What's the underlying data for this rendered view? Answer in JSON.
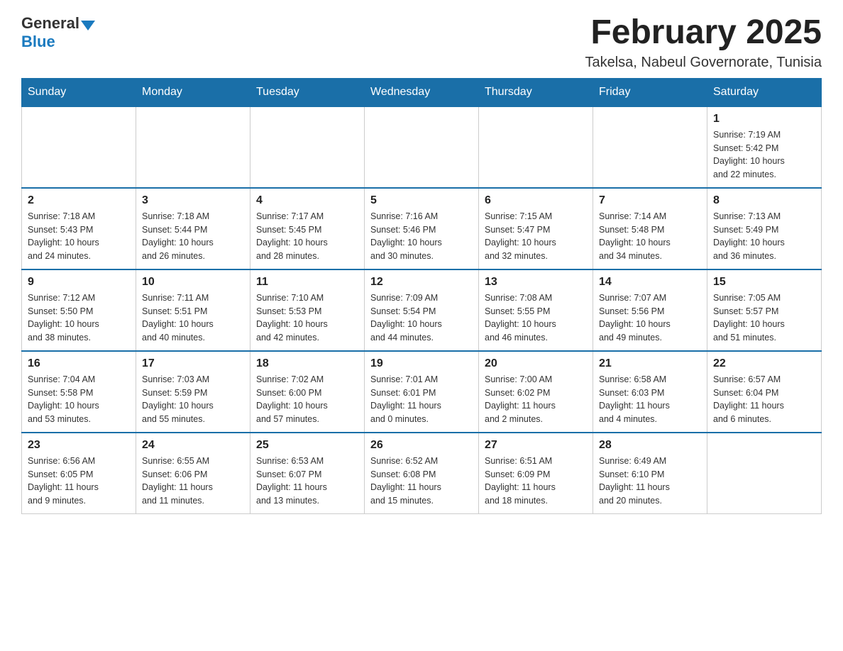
{
  "logo": {
    "general": "General",
    "blue": "Blue"
  },
  "title": "February 2025",
  "location": "Takelsa, Nabeul Governorate, Tunisia",
  "weekdays": [
    "Sunday",
    "Monday",
    "Tuesday",
    "Wednesday",
    "Thursday",
    "Friday",
    "Saturday"
  ],
  "weeks": [
    [
      {
        "day": "",
        "info": ""
      },
      {
        "day": "",
        "info": ""
      },
      {
        "day": "",
        "info": ""
      },
      {
        "day": "",
        "info": ""
      },
      {
        "day": "",
        "info": ""
      },
      {
        "day": "",
        "info": ""
      },
      {
        "day": "1",
        "info": "Sunrise: 7:19 AM\nSunset: 5:42 PM\nDaylight: 10 hours\nand 22 minutes."
      }
    ],
    [
      {
        "day": "2",
        "info": "Sunrise: 7:18 AM\nSunset: 5:43 PM\nDaylight: 10 hours\nand 24 minutes."
      },
      {
        "day": "3",
        "info": "Sunrise: 7:18 AM\nSunset: 5:44 PM\nDaylight: 10 hours\nand 26 minutes."
      },
      {
        "day": "4",
        "info": "Sunrise: 7:17 AM\nSunset: 5:45 PM\nDaylight: 10 hours\nand 28 minutes."
      },
      {
        "day": "5",
        "info": "Sunrise: 7:16 AM\nSunset: 5:46 PM\nDaylight: 10 hours\nand 30 minutes."
      },
      {
        "day": "6",
        "info": "Sunrise: 7:15 AM\nSunset: 5:47 PM\nDaylight: 10 hours\nand 32 minutes."
      },
      {
        "day": "7",
        "info": "Sunrise: 7:14 AM\nSunset: 5:48 PM\nDaylight: 10 hours\nand 34 minutes."
      },
      {
        "day": "8",
        "info": "Sunrise: 7:13 AM\nSunset: 5:49 PM\nDaylight: 10 hours\nand 36 minutes."
      }
    ],
    [
      {
        "day": "9",
        "info": "Sunrise: 7:12 AM\nSunset: 5:50 PM\nDaylight: 10 hours\nand 38 minutes."
      },
      {
        "day": "10",
        "info": "Sunrise: 7:11 AM\nSunset: 5:51 PM\nDaylight: 10 hours\nand 40 minutes."
      },
      {
        "day": "11",
        "info": "Sunrise: 7:10 AM\nSunset: 5:53 PM\nDaylight: 10 hours\nand 42 minutes."
      },
      {
        "day": "12",
        "info": "Sunrise: 7:09 AM\nSunset: 5:54 PM\nDaylight: 10 hours\nand 44 minutes."
      },
      {
        "day": "13",
        "info": "Sunrise: 7:08 AM\nSunset: 5:55 PM\nDaylight: 10 hours\nand 46 minutes."
      },
      {
        "day": "14",
        "info": "Sunrise: 7:07 AM\nSunset: 5:56 PM\nDaylight: 10 hours\nand 49 minutes."
      },
      {
        "day": "15",
        "info": "Sunrise: 7:05 AM\nSunset: 5:57 PM\nDaylight: 10 hours\nand 51 minutes."
      }
    ],
    [
      {
        "day": "16",
        "info": "Sunrise: 7:04 AM\nSunset: 5:58 PM\nDaylight: 10 hours\nand 53 minutes."
      },
      {
        "day": "17",
        "info": "Sunrise: 7:03 AM\nSunset: 5:59 PM\nDaylight: 10 hours\nand 55 minutes."
      },
      {
        "day": "18",
        "info": "Sunrise: 7:02 AM\nSunset: 6:00 PM\nDaylight: 10 hours\nand 57 minutes."
      },
      {
        "day": "19",
        "info": "Sunrise: 7:01 AM\nSunset: 6:01 PM\nDaylight: 11 hours\nand 0 minutes."
      },
      {
        "day": "20",
        "info": "Sunrise: 7:00 AM\nSunset: 6:02 PM\nDaylight: 11 hours\nand 2 minutes."
      },
      {
        "day": "21",
        "info": "Sunrise: 6:58 AM\nSunset: 6:03 PM\nDaylight: 11 hours\nand 4 minutes."
      },
      {
        "day": "22",
        "info": "Sunrise: 6:57 AM\nSunset: 6:04 PM\nDaylight: 11 hours\nand 6 minutes."
      }
    ],
    [
      {
        "day": "23",
        "info": "Sunrise: 6:56 AM\nSunset: 6:05 PM\nDaylight: 11 hours\nand 9 minutes."
      },
      {
        "day": "24",
        "info": "Sunrise: 6:55 AM\nSunset: 6:06 PM\nDaylight: 11 hours\nand 11 minutes."
      },
      {
        "day": "25",
        "info": "Sunrise: 6:53 AM\nSunset: 6:07 PM\nDaylight: 11 hours\nand 13 minutes."
      },
      {
        "day": "26",
        "info": "Sunrise: 6:52 AM\nSunset: 6:08 PM\nDaylight: 11 hours\nand 15 minutes."
      },
      {
        "day": "27",
        "info": "Sunrise: 6:51 AM\nSunset: 6:09 PM\nDaylight: 11 hours\nand 18 minutes."
      },
      {
        "day": "28",
        "info": "Sunrise: 6:49 AM\nSunset: 6:10 PM\nDaylight: 11 hours\nand 20 minutes."
      },
      {
        "day": "",
        "info": ""
      }
    ]
  ]
}
